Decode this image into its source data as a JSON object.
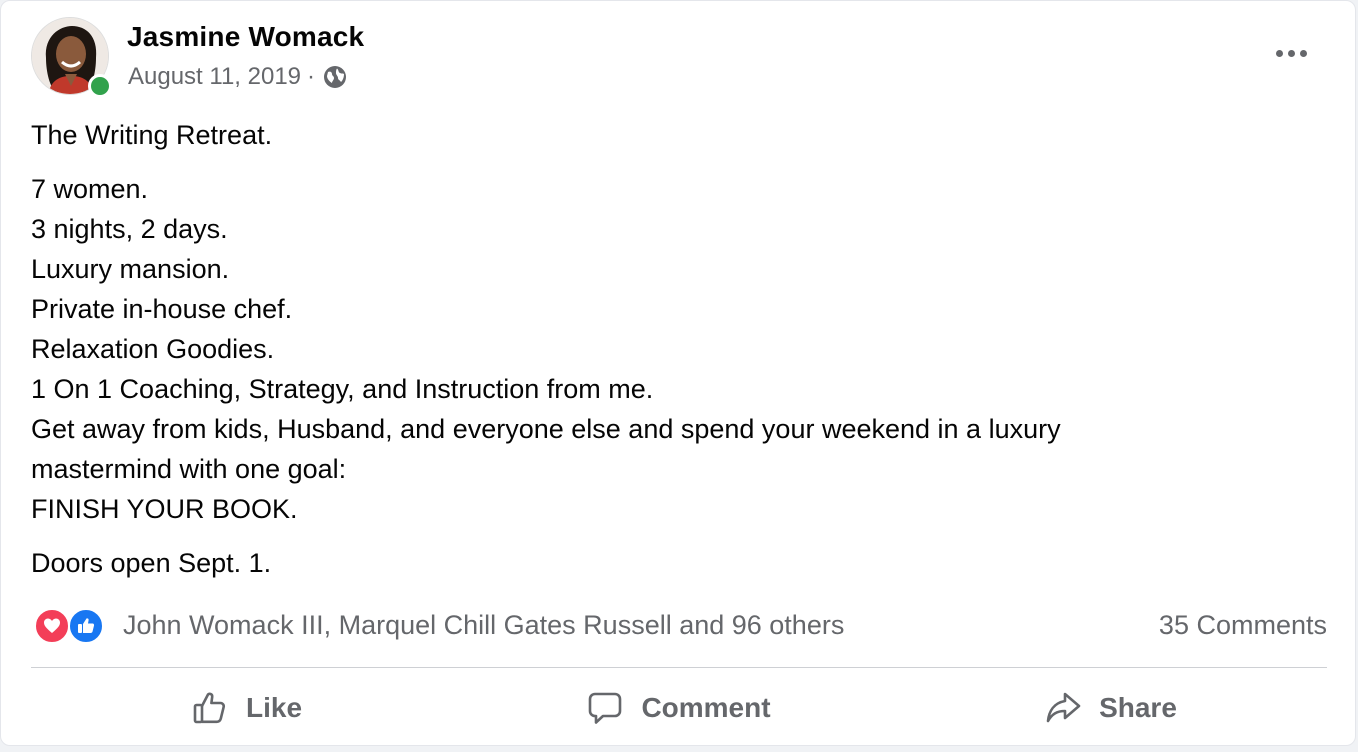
{
  "post": {
    "author": "Jasmine Womack",
    "date": "August 11, 2019",
    "separator": "·",
    "privacy_icon": "globe-icon",
    "online_status_color": "#31a24c",
    "lines": {
      "title": "The Writing Retreat.",
      "l1": "7 women.",
      "l2": "3 nights, 2 days.",
      "l3": "Luxury mansion.",
      "l4": "Private in-house chef.",
      "l5": "Relaxation Goodies.",
      "l6": "1 On 1 Coaching, Strategy, and Instruction from me.",
      "l7": "Get away from kids, Husband, and everyone else and spend your weekend in a luxury",
      "l8": "mastermind with one goal:",
      "l9": "FINISH YOUR BOOK.",
      "closing": "Doors open Sept. 1."
    }
  },
  "reactions": {
    "icons": [
      "love-reaction-icon",
      "like-reaction-icon"
    ],
    "love_color": "#f33e58",
    "like_color": "#1877f2",
    "names": "John Womack III, Marquel Chill Gates Russell and 96 others",
    "comments": "35 Comments"
  },
  "actions": {
    "like": "Like",
    "comment": "Comment",
    "share": "Share"
  }
}
